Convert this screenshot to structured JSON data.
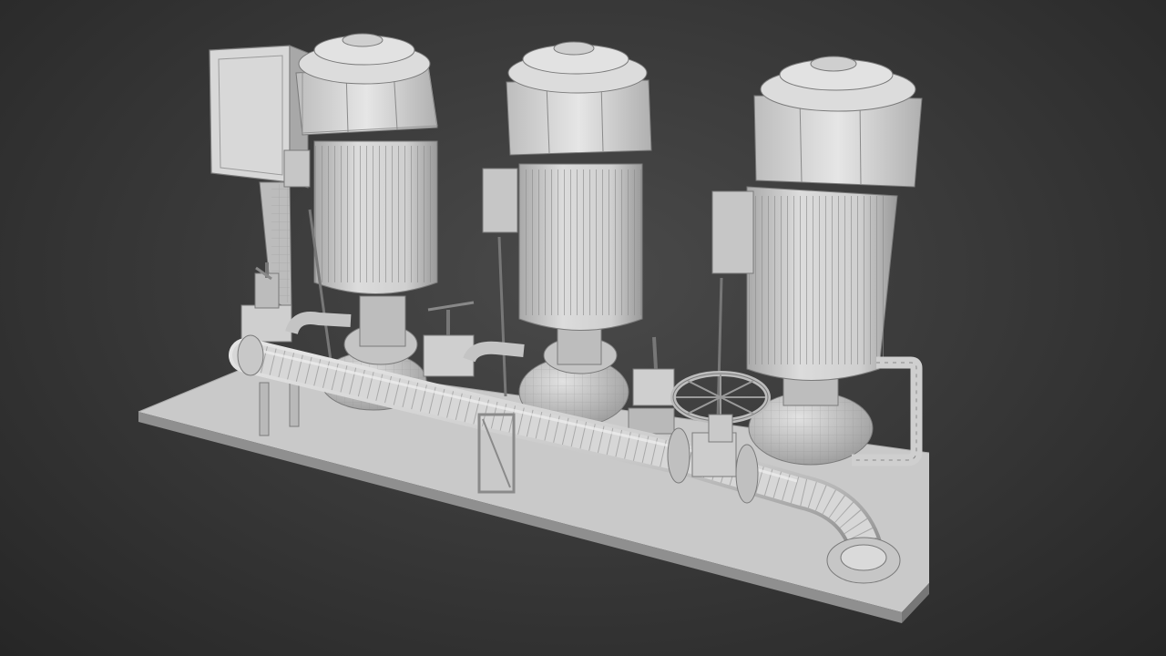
{
  "scene": {
    "subject": "pump-skid-wireframe-render",
    "colors": {
      "background": "#333333",
      "model": "#d4d4d4",
      "wire": "#8a8a8a",
      "shadow": "#1f1f1f"
    },
    "components": [
      {
        "id": "base-plate"
      },
      {
        "id": "control-panel"
      },
      {
        "id": "pump-left"
      },
      {
        "id": "pump-middle"
      },
      {
        "id": "pump-right"
      },
      {
        "id": "main-header-pipe"
      },
      {
        "id": "valve-wheel"
      }
    ]
  }
}
